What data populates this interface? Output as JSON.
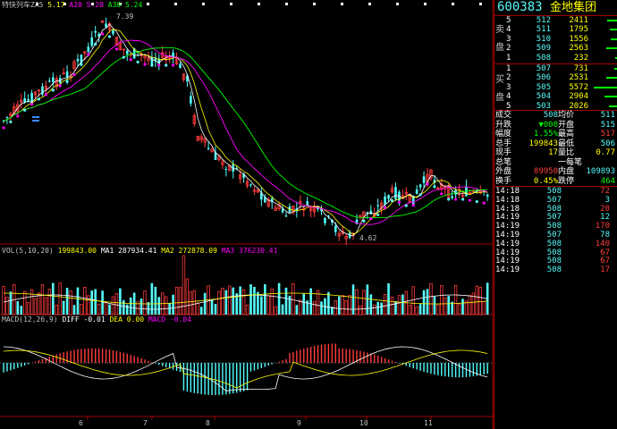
{
  "colors": {
    "up": "#ff3c3c",
    "down": "#54fcfc",
    "ma5": "#ffffff",
    "ma10": "#ffff00",
    "ma20": "#ff00ff",
    "ma30": "#00ff00",
    "frame": "#a00000",
    "price_blue": "#54fcfc",
    "price_red": "#ff3c3c",
    "yellow": "#ffff00",
    "white": "#ffffff",
    "green": "#00ff00"
  },
  "header": {
    "indicator": "特快列车ZA5",
    "ma_a_label": "5.17",
    "ma_b_label": "A20",
    "ma_b_value": "5.28",
    "ma_c_label": "A30",
    "ma_c_value": "5.24"
  },
  "price_annotations": {
    "high": "7.39",
    "low": "4.62"
  },
  "volume_header": {
    "label": "VOL(5,10,20)",
    "vol": "199843.00",
    "ma1_label": "MA1",
    "ma1": "287934.41",
    "ma2_label": "MA2",
    "ma2": "272878.09",
    "ma3_label": "MA3",
    "ma3": "376230.41"
  },
  "macd_header": {
    "label": "MACD(12,26,9)",
    "diff_label": "DIFF",
    "diff": "-0.01",
    "dea_label": "DEA",
    "dea": "0.00",
    "macd_label": "MACD",
    "macd": "-0.04"
  },
  "x_axis_labels": [
    "6",
    "7",
    "8",
    "9",
    "10",
    "11"
  ],
  "stock": {
    "code": "600383",
    "name": "金地集团"
  },
  "sell_orders": [
    {
      "level": "5",
      "price": "512",
      "volume": "2411"
    },
    {
      "level": "4",
      "price": "511",
      "volume": "1795"
    },
    {
      "level": "3",
      "price": "510",
      "volume": "1556"
    },
    {
      "level": "2",
      "price": "509",
      "volume": "2563"
    },
    {
      "level": "1",
      "price": "508",
      "volume": "232"
    }
  ],
  "buy_orders": [
    {
      "level": "1",
      "price": "507",
      "volume": "731"
    },
    {
      "level": "2",
      "price": "506",
      "volume": "2531"
    },
    {
      "level": "3",
      "price": "505",
      "volume": "5572"
    },
    {
      "level": "4",
      "price": "504",
      "volume": "2904"
    },
    {
      "level": "5",
      "price": "503",
      "volume": "2026"
    }
  ],
  "sell_side_label": [
    "卖",
    "盘"
  ],
  "buy_side_label": [
    "买",
    "盘"
  ],
  "stats": [
    {
      "l1": "成交",
      "v1": "508",
      "l2": "均价",
      "v2": "511"
    },
    {
      "l1": "升跌",
      "v1": "▼008",
      "l2": "开盘",
      "v2": "515"
    },
    {
      "l1": "幅度",
      "v1": "1.55%",
      "l2": "最高",
      "v2": "517"
    },
    {
      "l1": "总手",
      "v1": "199843",
      "l2": "最低",
      "v2": "506"
    },
    {
      "l1": "现手",
      "v1": "17",
      "l2": "量比",
      "v2": "0.77"
    },
    {
      "l1": "总笔",
      "v1": "",
      "l2": "一每笔",
      "v2": ""
    },
    {
      "l1": "外盘",
      "v1": "89950",
      "l2": "内盘",
      "v2": "109893"
    },
    {
      "l1": "换手",
      "v1": "0.45%",
      "l2": "跌停",
      "v2": "464"
    }
  ],
  "ticks": [
    {
      "time": "14:18",
      "price": "508",
      "vol": "72"
    },
    {
      "time": "14:18",
      "price": "507",
      "vol": "3"
    },
    {
      "time": "14:18",
      "price": "508",
      "vol": "20"
    },
    {
      "time": "14:19",
      "price": "507",
      "vol": "12"
    },
    {
      "time": "14:19",
      "price": "508",
      "vol": "170"
    },
    {
      "time": "14:19",
      "price": "507",
      "vol": "78"
    },
    {
      "time": "14:19",
      "price": "508",
      "vol": "140"
    },
    {
      "time": "14:19",
      "price": "508",
      "vol": "67"
    },
    {
      "time": "14:19",
      "price": "508",
      "vol": "67"
    },
    {
      "time": "14:19",
      "price": "508",
      "vol": "17"
    }
  ]
}
